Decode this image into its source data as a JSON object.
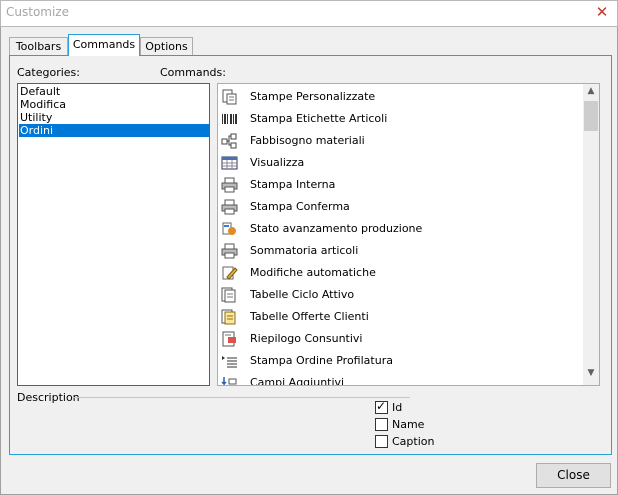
{
  "window": {
    "title": "Customize",
    "close_glyph": "✕"
  },
  "tabs": [
    {
      "label": "Toolbars",
      "active": false
    },
    {
      "label": "Commands",
      "active": true
    },
    {
      "label": "Options",
      "active": false
    }
  ],
  "categories": {
    "label": "Categories:",
    "items": [
      "Default",
      "Modifica",
      "Utility",
      "Ordini"
    ],
    "selected": "Ordini"
  },
  "commands": {
    "label": "Commands:",
    "items": [
      {
        "label": "Stampe Personalizzate",
        "icon": "custom-print-icon"
      },
      {
        "label": "Stampa Etichette Articoli",
        "icon": "barcode-icon"
      },
      {
        "label": "Fabbisogno materiali",
        "icon": "tree-structure-icon"
      },
      {
        "label": "Visualizza",
        "icon": "grid-view-icon"
      },
      {
        "label": "Stampa Interna",
        "icon": "printer-icon"
      },
      {
        "label": "Stampa Conferma",
        "icon": "printer-icon"
      },
      {
        "label": "Stato avanzamento produzione",
        "icon": "production-status-icon"
      },
      {
        "label": "Sommatoria articoli",
        "icon": "printer-icon"
      },
      {
        "label": "Modifiche automatiche",
        "icon": "auto-edit-icon"
      },
      {
        "label": "Tabelle Ciclo Attivo",
        "icon": "document-stack-icon"
      },
      {
        "label": "Tabelle Offerte Clienti",
        "icon": "offer-document-icon"
      },
      {
        "label": "Riepilogo Consuntivi",
        "icon": "summary-report-icon"
      },
      {
        "label": "Stampa Ordine Profilatura",
        "icon": "indent-list-icon"
      },
      {
        "label": "Campi Aggiuntivi",
        "icon": "extra-fields-icon"
      }
    ]
  },
  "description": {
    "label": "Description",
    "options": [
      {
        "label": "Id",
        "checked": true
      },
      {
        "label": "Name",
        "checked": false
      },
      {
        "label": "Caption",
        "checked": false
      }
    ]
  },
  "footer": {
    "close_label": "Close"
  }
}
